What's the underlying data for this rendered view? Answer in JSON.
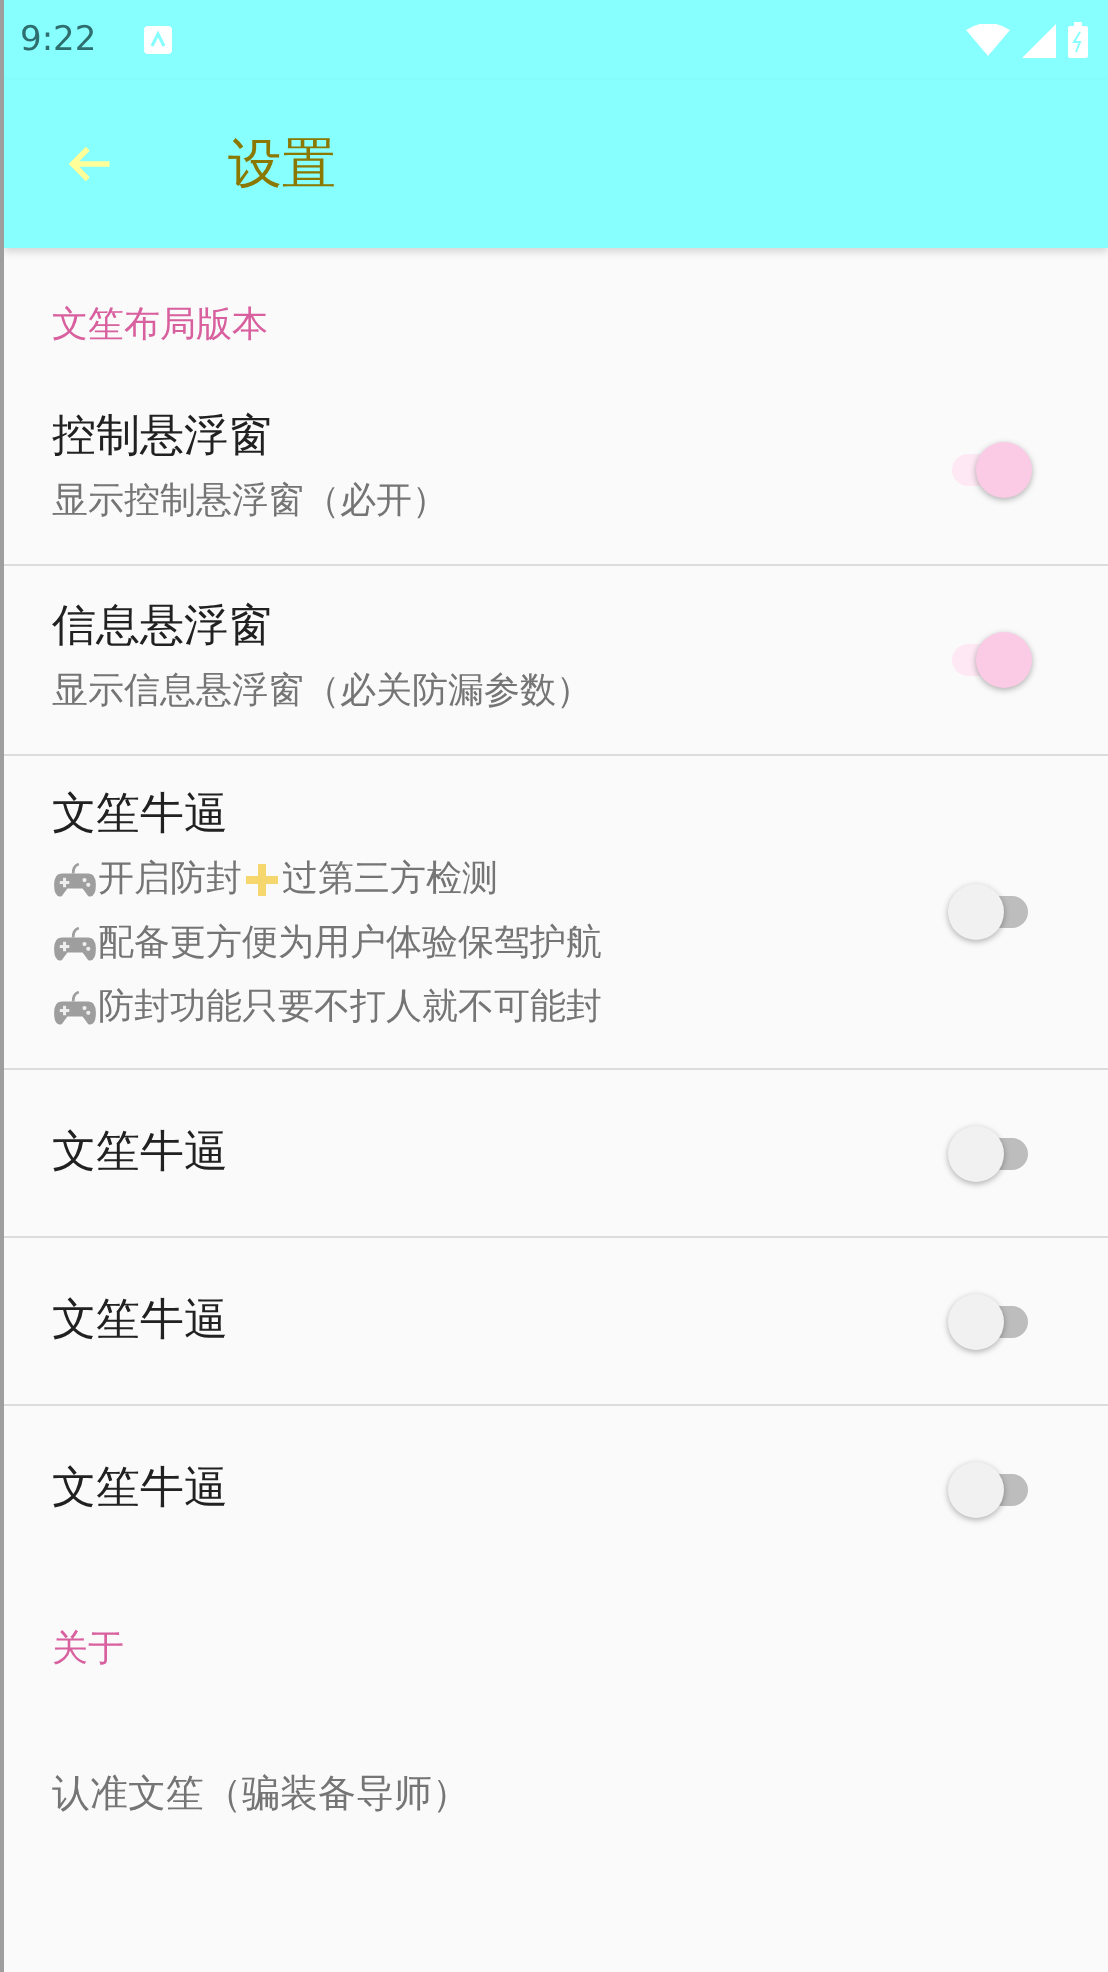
{
  "status_bar": {
    "time": "9:22"
  },
  "toolbar": {
    "title": "设置"
  },
  "sections": [
    {
      "header": "文笙布局版本",
      "items": [
        {
          "kind": "switch",
          "title": "控制悬浮窗",
          "summary": [
            [
              {
                "kind": "text",
                "text": "显示控制悬浮窗（必开）"
              }
            ]
          ],
          "on": true
        },
        {
          "kind": "switch",
          "title": "信息悬浮窗",
          "summary": [
            [
              {
                "kind": "text",
                "text": "显示信息悬浮窗（必关防漏参数）"
              }
            ]
          ],
          "on": true
        },
        {
          "kind": "switch",
          "title": "文笙牛逼",
          "summary": [
            [
              {
                "kind": "gamepad"
              },
              {
                "kind": "text",
                "text": "开启防封"
              },
              {
                "kind": "plus"
              },
              {
                "kind": "text",
                "text": "过第三方检测"
              }
            ],
            [
              {
                "kind": "gamepad"
              },
              {
                "kind": "text",
                "text": "配备更方便为用户体验保驾护航"
              }
            ],
            [
              {
                "kind": "gamepad"
              },
              {
                "kind": "text",
                "text": "防封功能只要不打人就不可能封"
              }
            ]
          ],
          "on": false
        },
        {
          "kind": "switch",
          "title": "文笙牛逼",
          "on": false
        },
        {
          "kind": "switch",
          "title": "文笙牛逼",
          "on": false
        },
        {
          "kind": "switch",
          "title": "文笙牛逼",
          "on": false
        }
      ]
    },
    {
      "header": "关于",
      "items": [
        {
          "kind": "plain",
          "summary": [
            [
              {
                "kind": "text",
                "text": "认准文笙（骗装备导师）"
              }
            ]
          ]
        }
      ]
    }
  ]
}
